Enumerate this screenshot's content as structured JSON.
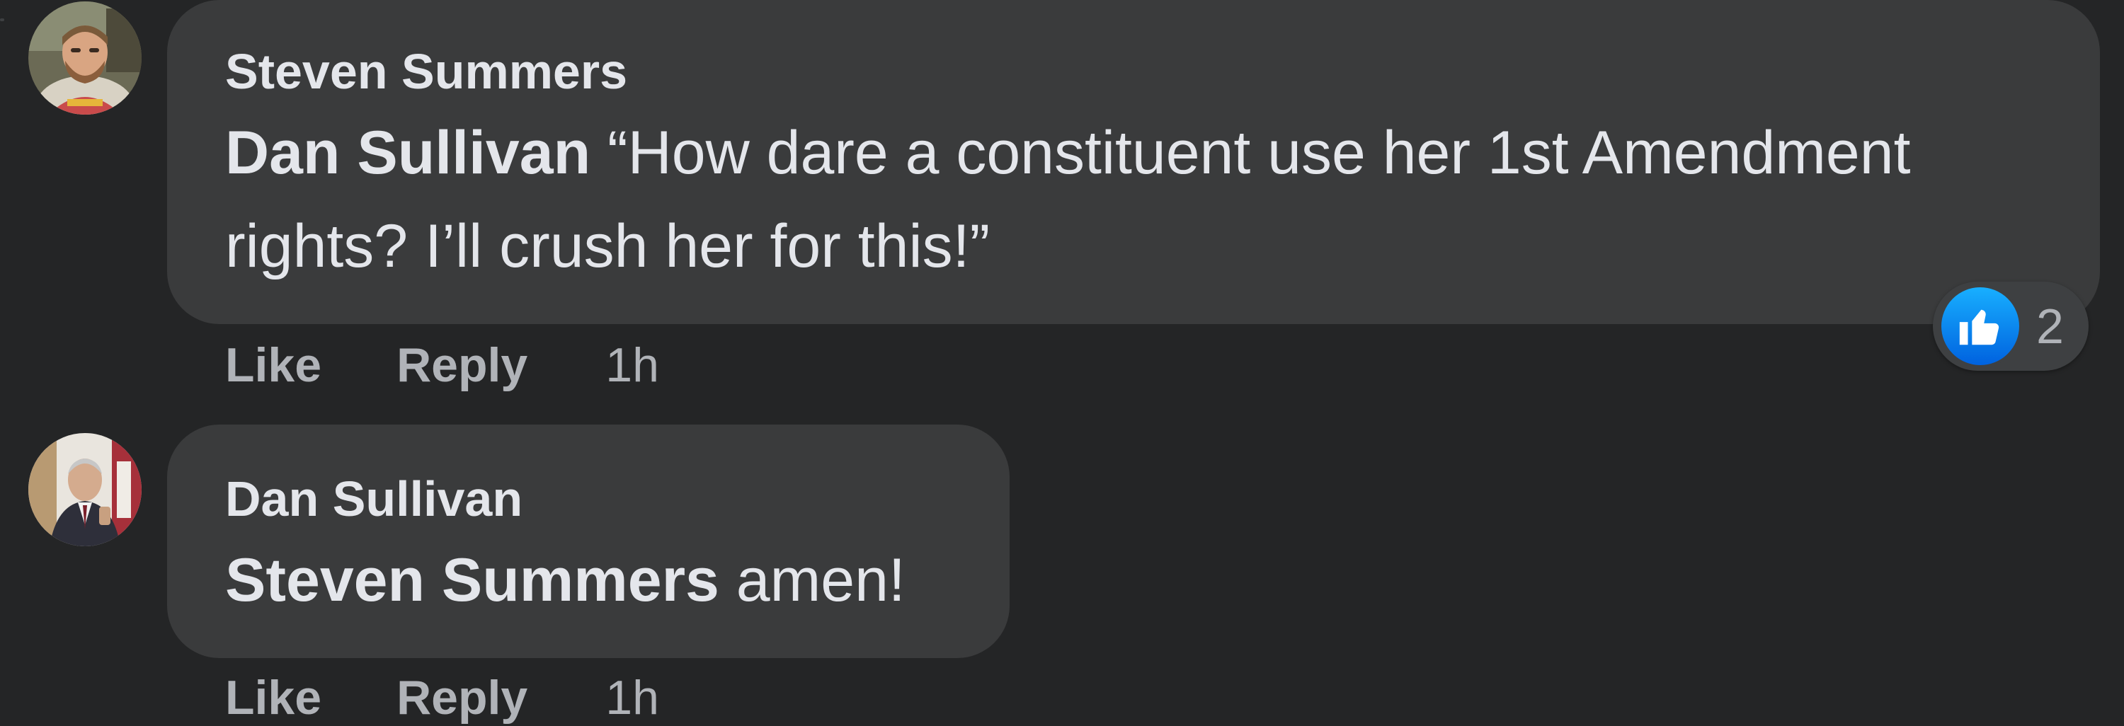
{
  "colors": {
    "background": "#242526",
    "bubble": "#3a3b3c",
    "text_primary": "#e4e6eb",
    "text_secondary": "#b0b3b8",
    "like_blue": "#1877f2"
  },
  "comments": [
    {
      "author": "Steven Summers",
      "avatar_icon": "profile-avatar",
      "mention": "Dan Sullivan",
      "text": " “How dare a constituent use her 1st Amendment rights? I’ll crush her for this!”",
      "actions": {
        "like_label": "Like",
        "reply_label": "Reply",
        "timestamp": "1h"
      },
      "reactions": {
        "icon": "thumbs-up-icon",
        "count": "2"
      }
    },
    {
      "author": "Dan Sullivan",
      "avatar_icon": "profile-avatar",
      "mention": "Steven Summers",
      "text": " amen!",
      "actions": {
        "like_label": "Like",
        "reply_label": "Reply",
        "timestamp": "1h"
      }
    }
  ]
}
